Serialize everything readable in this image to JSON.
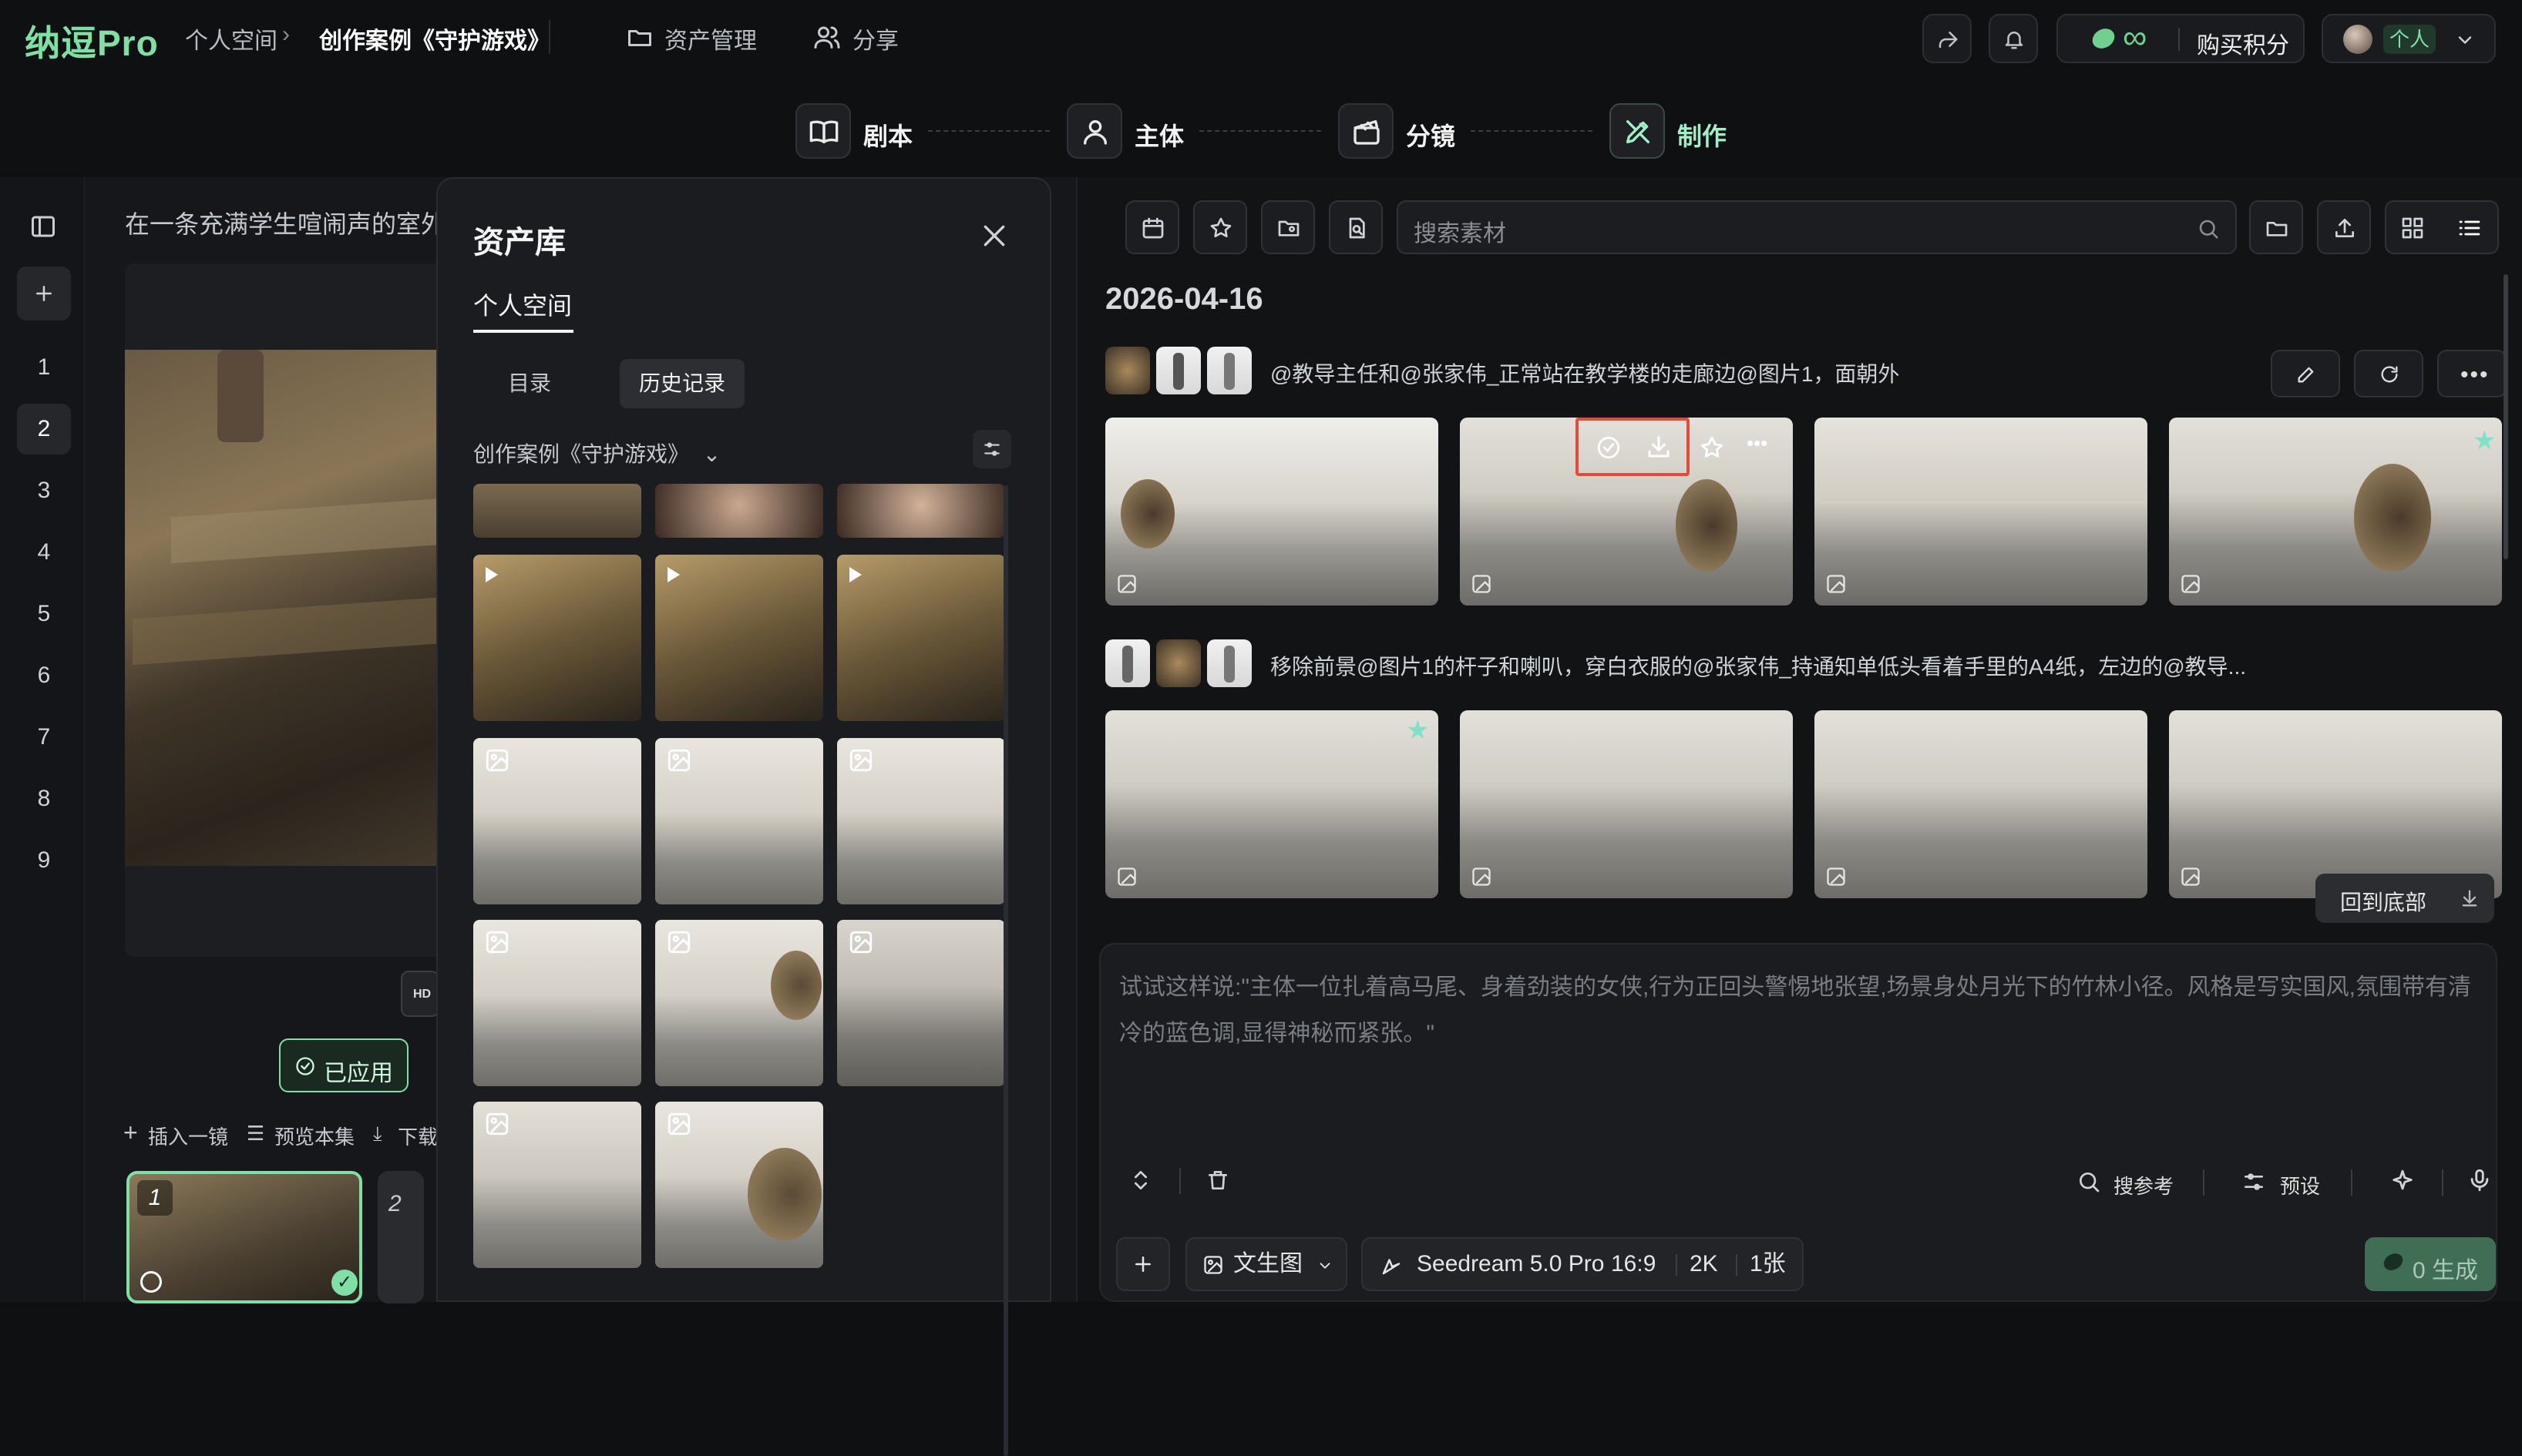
{
  "app": {
    "logo": "纳逗Pro"
  },
  "breadcrumb": {
    "space": "个人空间",
    "sep": "›",
    "project": "创作案例《守护游戏》"
  },
  "nav": {
    "assets": "资产管理",
    "share": "分享"
  },
  "account": {
    "credits": "∞",
    "buy": "购买积分",
    "user": "个人"
  },
  "steps": [
    {
      "label": "剧本"
    },
    {
      "label": "主体"
    },
    {
      "label": "分镜"
    },
    {
      "label": "制作"
    }
  ],
  "rail": {
    "numbers": [
      "1",
      "2",
      "3",
      "4",
      "5",
      "6",
      "7",
      "8",
      "9"
    ],
    "active": "2"
  },
  "editor": {
    "description": "在一条充满学生喧闹声的室外",
    "applied": "已应用",
    "insert": "插入一镜",
    "preview": "预览本集",
    "download": "下载",
    "shot1": "1",
    "shot2": "2",
    "hd": "HD"
  },
  "asset_panel": {
    "title": "资产库",
    "tab": "个人空间",
    "sub_tabs": [
      "目录",
      "历史记录"
    ],
    "active_sub_tab": "历史记录",
    "folder": "创作案例《守护游戏》"
  },
  "right": {
    "search_placeholder": "搜索素材",
    "date": "2026-04-16",
    "row1_prompt": "@教导主任和@张家伟_正常站在教学楼的走廊边@图片1，面朝外",
    "row2_prompt": "移除前景@图片1的杆子和喇叭，穿白衣服的@张家伟_持通知单低头看着手里的A4纸，左边的@教导...",
    "back_bottom": "回到底部"
  },
  "prompt": {
    "placeholder": "试试这样说:\"主体一位扎着高马尾、身着劲装的女侠,行为正回头警惕地张望,场景身处月光下的竹林小径。风格是写实国风,氛围带有清冷的蓝色调,显得神秘而紧张。\"",
    "ref_search": "搜参考",
    "preset": "预设",
    "mode": "文生图",
    "model": "Seedream 5.0 Pro",
    "ratio": "16:9",
    "res": "2K",
    "count": "1张",
    "generate": "0 生成"
  },
  "colors": {
    "accent": "#7fe0a6",
    "star": "#7de3c8",
    "highlight": "#e5493a"
  }
}
